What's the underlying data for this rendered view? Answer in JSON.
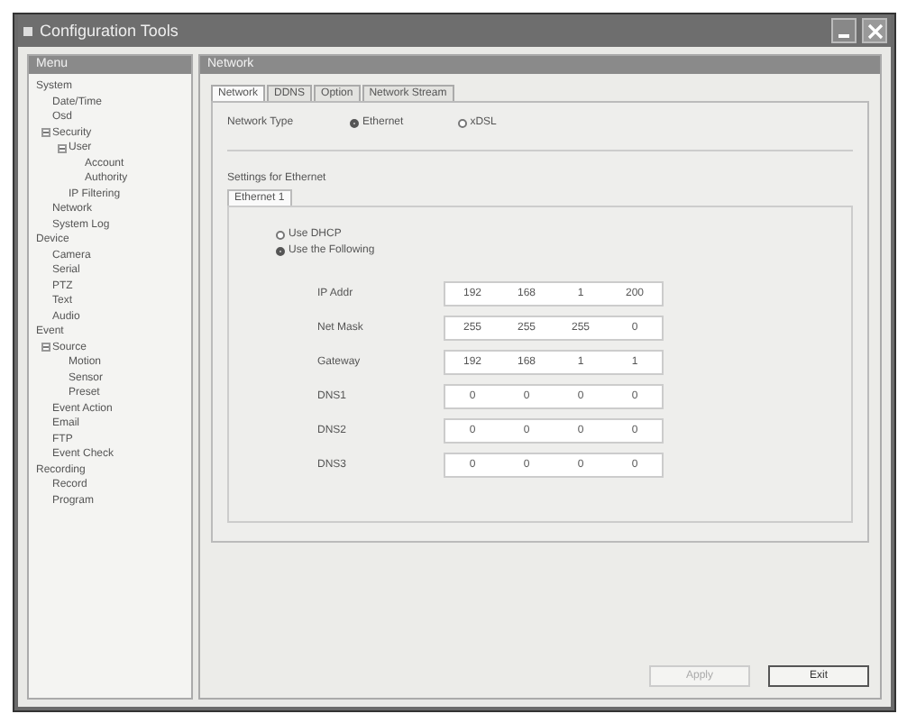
{
  "window": {
    "title": "Configuration Tools"
  },
  "menu_panel": {
    "title": "Menu",
    "tree": [
      {
        "label": "System",
        "children": [
          {
            "label": "Date/Time"
          },
          {
            "label": "Osd"
          },
          {
            "label": "Security",
            "expanded": true,
            "children": [
              {
                "label": "User",
                "expanded": true,
                "children": [
                  {
                    "label": "Account"
                  },
                  {
                    "label": "Authority"
                  }
                ]
              },
              {
                "label": "IP Filtering"
              }
            ]
          },
          {
            "label": "Network"
          },
          {
            "label": "System Log"
          }
        ]
      },
      {
        "label": "Device",
        "children": [
          {
            "label": "Camera"
          },
          {
            "label": "Serial"
          },
          {
            "label": "PTZ"
          },
          {
            "label": "Text"
          },
          {
            "label": "Audio"
          }
        ]
      },
      {
        "label": "Event",
        "children": [
          {
            "label": "Source",
            "expanded": true,
            "children": [
              {
                "label": "Motion"
              },
              {
                "label": "Sensor"
              },
              {
                "label": "Preset"
              }
            ]
          },
          {
            "label": "Event Action"
          },
          {
            "label": "Email"
          },
          {
            "label": "FTP"
          },
          {
            "label": "Event Check"
          }
        ]
      },
      {
        "label": "Recording",
        "children": [
          {
            "label": "Record"
          },
          {
            "label": "Program"
          }
        ]
      }
    ]
  },
  "content_panel": {
    "title": "Network",
    "tabs": [
      {
        "label": "Network",
        "selected": true
      },
      {
        "label": "DDNS",
        "selected": false
      },
      {
        "label": "Option",
        "selected": false
      },
      {
        "label": "Network Stream",
        "selected": false
      }
    ],
    "network_type": {
      "label": "Network Type",
      "options": [
        {
          "label": "Ethernet",
          "selected": true
        },
        {
          "label": "xDSL",
          "selected": false
        }
      ]
    },
    "settings_label": "Settings for Ethernet",
    "sub_tabs": [
      {
        "label": "Ethernet 1",
        "selected": true
      }
    ],
    "address_mode": [
      {
        "label": "Use DHCP",
        "selected": false
      },
      {
        "label": "Use the Following",
        "selected": true
      }
    ],
    "fields": [
      {
        "label": "IP Addr",
        "octets": [
          "192",
          "168",
          "1",
          "200"
        ]
      },
      {
        "label": "Net Mask",
        "octets": [
          "255",
          "255",
          "255",
          "0"
        ]
      },
      {
        "label": "Gateway",
        "octets": [
          "192",
          "168",
          "1",
          "1"
        ]
      },
      {
        "label": "DNS1",
        "octets": [
          "0",
          "0",
          "0",
          "0"
        ]
      },
      {
        "label": "DNS2",
        "octets": [
          "0",
          "0",
          "0",
          "0"
        ]
      },
      {
        "label": "DNS3",
        "octets": [
          "0",
          "0",
          "0",
          "0"
        ]
      }
    ]
  },
  "buttons": [
    {
      "label": "Apply",
      "disabled": true
    },
    {
      "label": "Exit",
      "disabled": false
    }
  ]
}
